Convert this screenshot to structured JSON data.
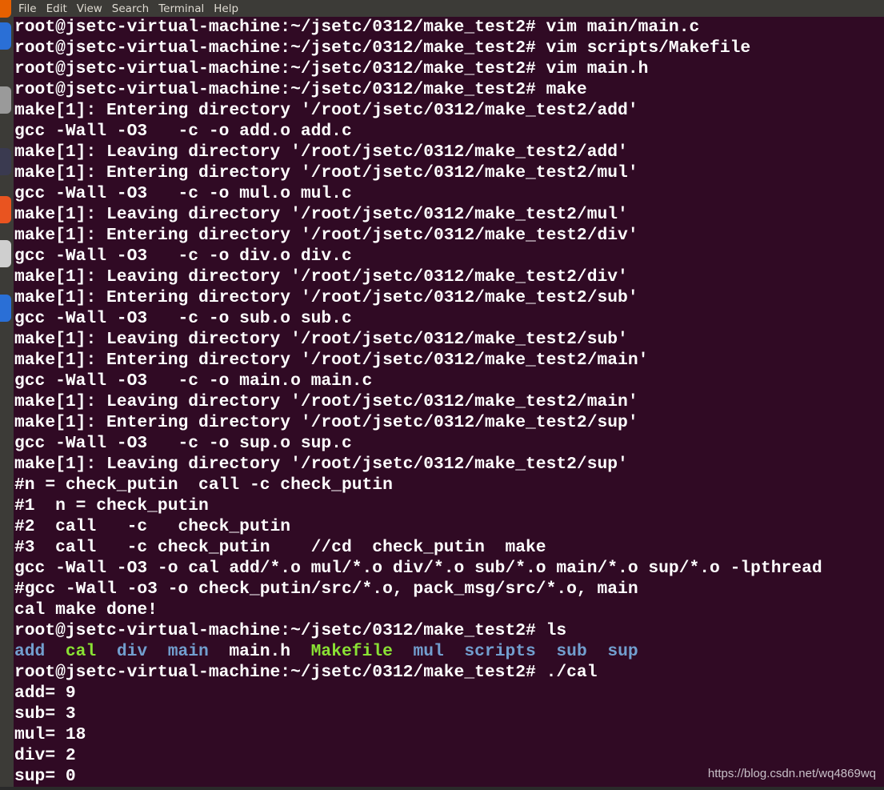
{
  "menu": [
    "File",
    "Edit",
    "View",
    "Search",
    "Terminal",
    "Help"
  ],
  "colors": {
    "background": "#300a24",
    "directory": "#729fcf",
    "executable": "#8ae234",
    "text": "#ffffff"
  },
  "dock_icons": [
    "firefox-icon",
    "thunderbird-icon",
    "files-icon",
    "rhythmbox-icon",
    "software-center-icon",
    "terminal-icon",
    "help-icon"
  ],
  "lines_before": [
    "root@jsetc-virtual-machine:~/jsetc/0312/make_test2# vim main/main.c",
    "root@jsetc-virtual-machine:~/jsetc/0312/make_test2# vim scripts/Makefile",
    "root@jsetc-virtual-machine:~/jsetc/0312/make_test2# vim main.h",
    "root@jsetc-virtual-machine:~/jsetc/0312/make_test2# make",
    "make[1]: Entering directory '/root/jsetc/0312/make_test2/add'",
    "gcc -Wall -O3   -c -o add.o add.c",
    "make[1]: Leaving directory '/root/jsetc/0312/make_test2/add'",
    "make[1]: Entering directory '/root/jsetc/0312/make_test2/mul'",
    "gcc -Wall -O3   -c -o mul.o mul.c",
    "make[1]: Leaving directory '/root/jsetc/0312/make_test2/mul'",
    "make[1]: Entering directory '/root/jsetc/0312/make_test2/div'",
    "gcc -Wall -O3   -c -o div.o div.c",
    "make[1]: Leaving directory '/root/jsetc/0312/make_test2/div'",
    "make[1]: Entering directory '/root/jsetc/0312/make_test2/sub'",
    "gcc -Wall -O3   -c -o sub.o sub.c",
    "make[1]: Leaving directory '/root/jsetc/0312/make_test2/sub'",
    "make[1]: Entering directory '/root/jsetc/0312/make_test2/main'",
    "gcc -Wall -O3   -c -o main.o main.c",
    "make[1]: Leaving directory '/root/jsetc/0312/make_test2/main'",
    "make[1]: Entering directory '/root/jsetc/0312/make_test2/sup'",
    "gcc -Wall -O3   -c -o sup.o sup.c",
    "make[1]: Leaving directory '/root/jsetc/0312/make_test2/sup'",
    "#n = check_putin  call -c check_putin",
    "#1  n = check_putin",
    "#2  call   -c   check_putin",
    "#3  call   -c check_putin    //cd  check_putin  make",
    "gcc -Wall -O3 -o cal add/*.o mul/*.o div/*.o sub/*.o main/*.o sup/*.o -lpthread",
    "#gcc -Wall -o3 -o check_putin/src/*.o, pack_msg/src/*.o, main",
    "cal make done!",
    "root@jsetc-virtual-machine:~/jsetc/0312/make_test2# ls"
  ],
  "ls_output": [
    {
      "name": "add",
      "type": "directory"
    },
    {
      "name": "cal",
      "type": "executable"
    },
    {
      "name": "div",
      "type": "directory"
    },
    {
      "name": "main",
      "type": "directory"
    },
    {
      "name": "main.h",
      "type": "file"
    },
    {
      "name": "Makefile",
      "type": "executable"
    },
    {
      "name": "mul",
      "type": "directory"
    },
    {
      "name": "scripts",
      "type": "directory"
    },
    {
      "name": "sub",
      "type": "directory"
    },
    {
      "name": "sup",
      "type": "directory"
    }
  ],
  "lines_after": [
    "root@jsetc-virtual-machine:~/jsetc/0312/make_test2# ./cal",
    "add= 9",
    "sub= 3",
    "mul= 18",
    "div= 2",
    "sup= 0"
  ],
  "watermark": "https://blog.csdn.net/wq4869wq"
}
